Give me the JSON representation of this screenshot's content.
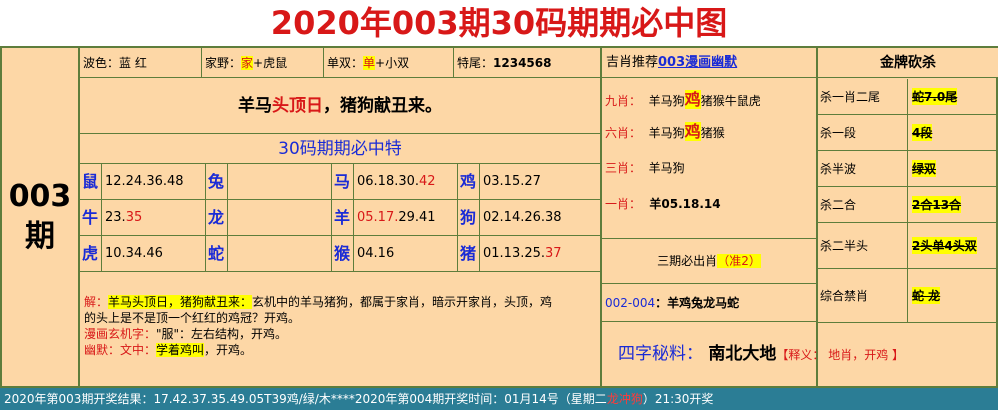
{
  "title": "2020年003期30码期期必中图",
  "issue": {
    "num": "003",
    "unit": "期"
  },
  "info_row": {
    "color_label": "波色：",
    "color_value": "蓝 红",
    "domestic_label": "家野：",
    "domestic_hl": "家",
    "domestic_rest": "+虎鼠",
    "oddeven_label": "单双：",
    "oddeven_hl": "单",
    "oddeven_rest": "+小双",
    "tail_label": "特尾：",
    "tail_value": "1234568"
  },
  "poem": {
    "pre": "羊马",
    "hl": "头顶日",
    "post": "，猪狗献丑来。"
  },
  "subtitle": "30码期期必中特",
  "zodiac_rows": [
    [
      {
        "animal": "鼠",
        "nums": "12.24.36.48",
        "red": ""
      },
      {
        "animal": "兔",
        "nums": "",
        "red": ""
      },
      {
        "animal": "马",
        "nums": "06.18.30.",
        "red": "42"
      },
      {
        "animal": "鸡",
        "nums": "03.15.27",
        "red": ""
      }
    ],
    [
      {
        "animal": "牛",
        "nums": "23.",
        "red": "35"
      },
      {
        "animal": "龙",
        "nums": "",
        "red": ""
      },
      {
        "animal": "羊",
        "nums": "",
        "red": "05.17.",
        "tail": "29.41"
      },
      {
        "animal": "狗",
        "nums": "02.14.26.38",
        "red": ""
      }
    ],
    [
      {
        "animal": "虎",
        "nums": "10.34.46",
        "red": ""
      },
      {
        "animal": "蛇",
        "nums": "",
        "red": ""
      },
      {
        "animal": "猴",
        "nums": "04.16",
        "red": ""
      },
      {
        "animal": "猪",
        "nums": "01.13.25.",
        "red": "37"
      }
    ]
  ],
  "explanation": {
    "l1_label": "解：",
    "l1_hl": "羊马头顶日，猪狗献丑来：",
    "l1_text": "玄机中的羊马猪狗，都属于家肖，暗示开家肖，头顶，鸡",
    "l2_text": "的头上是不是顶一个红红的鸡冠？开鸡。",
    "l3_label": "漫画玄机字：",
    "l3_text": "\"服\"：左右结构，开鸡。",
    "l4_label": "幽默：文中：",
    "l4_hl": "学着鸡叫",
    "l4_text": "，开鸡。"
  },
  "recommend": {
    "pre": "吉肖推荐",
    "link": "003漫画幽默"
  },
  "tips": [
    {
      "k": "九肖：",
      "pre": "羊马狗",
      "red": "鸡",
      "post": "猪猴牛鼠虎"
    },
    {
      "k": "六肖：",
      "pre": "羊马狗",
      "red": "鸡",
      "post": "猪猴"
    },
    {
      "k": "三肖：",
      "pre": "羊马狗",
      "red": "",
      "post": ""
    },
    {
      "k": "一肖：",
      "pre": "羊05.18.14",
      "red": "",
      "post": ""
    }
  ],
  "three_must": {
    "pre": "三期必出肖",
    "hl": "（准2）"
  },
  "range": {
    "blue": "002-004",
    "text": "：羊鸡兔龙马蛇"
  },
  "secret": {
    "label": "四字秘料：",
    "words": "南北大地",
    "note": "【释义： 地肖，开鸡 】"
  },
  "gold_head": "金牌砍杀",
  "kills": [
    {
      "label": "杀一肖二尾",
      "value": "蛇7.0尾"
    },
    {
      "label": "杀一段",
      "value": "4段"
    },
    {
      "label": "杀半波",
      "value": "绿双"
    },
    {
      "label": "杀二合",
      "value": "2合13合"
    },
    {
      "label": "杀二半头",
      "value": "2头单4头双"
    },
    {
      "label": "综合禁肖",
      "value": "蛇 龙"
    }
  ],
  "footer": {
    "result": "2020年第003期开奖结果：17.42.37.35.49.05T39鸡/绿/木****",
    "next_pre": "2020年第004期开奖时间：01月14号（星期二",
    "next_red": "龙冲狗",
    "next_post": "）21:30开奖"
  }
}
